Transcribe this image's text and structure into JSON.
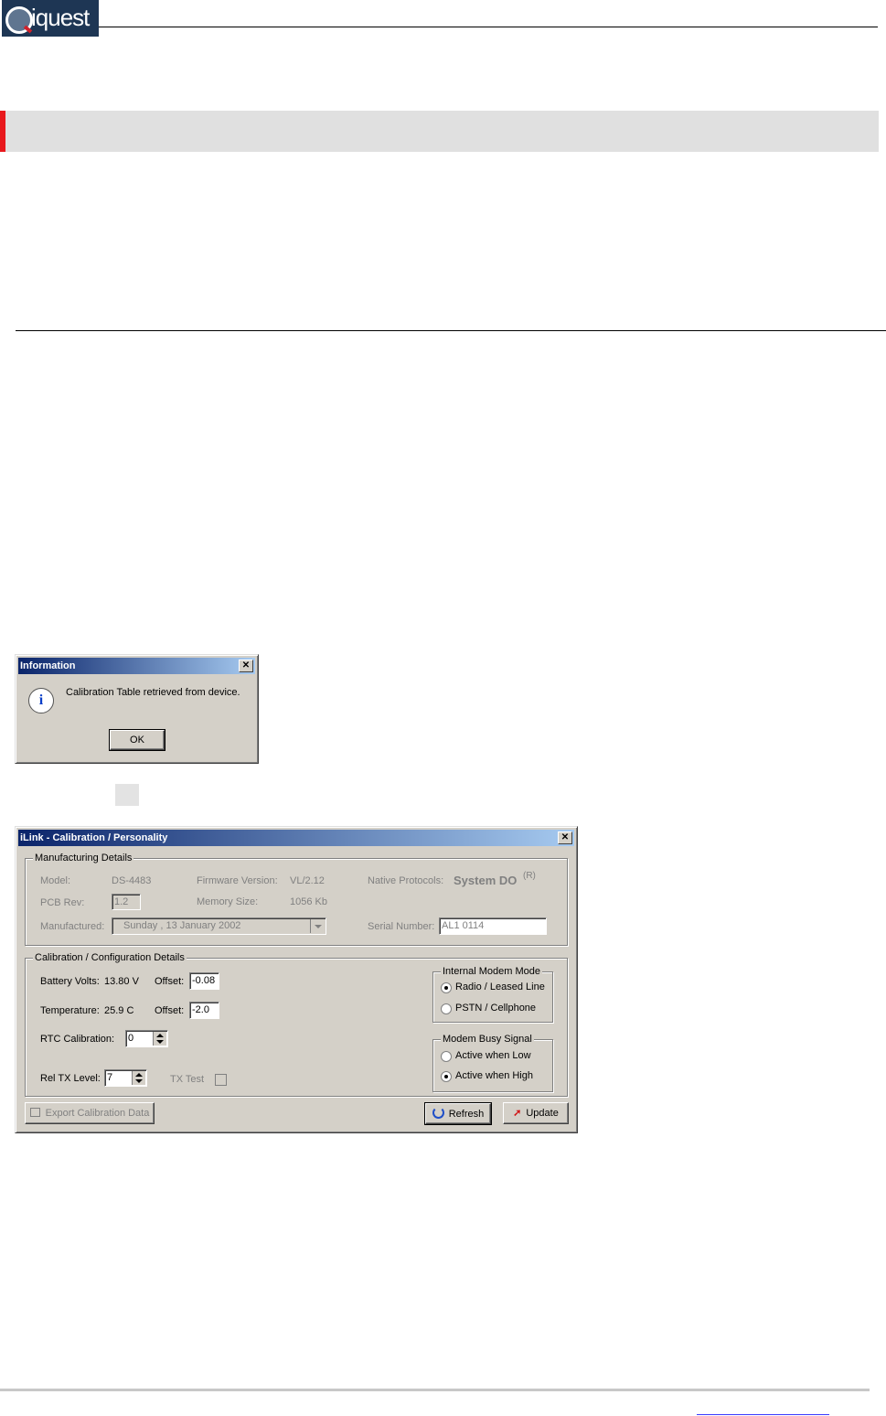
{
  "header": {
    "logo_text": "iquest"
  },
  "info_dialog": {
    "title": "Information",
    "close_glyph": "✕",
    "message": "Calibration Table retrieved from device.",
    "ok_label": "OK"
  },
  "cal_dialog": {
    "title": "iLink - Calibration / Personality",
    "close_glyph": "✕",
    "manufacturing": {
      "caption": "Manufacturing Details",
      "model_label": "Model:",
      "model_value": "DS-4483",
      "firmware_label": "Firmware Version:",
      "firmware_value": "VL/2.12",
      "protocols_label": "Native Protocols:",
      "protocols_value": "System DO",
      "protocols_mark": "(R)",
      "pcb_label": "PCB Rev:",
      "pcb_value": "1.2",
      "memory_label": "Memory Size:",
      "memory_value": "1056 Kb",
      "manufactured_label": "Manufactured:",
      "manufactured_value": "Sunday   , 13   January   2002",
      "serial_label": "Serial Number:",
      "serial_value": "AL1 0114"
    },
    "calibration": {
      "caption": "Calibration / Configuration Details",
      "battery_label": "Battery Volts:",
      "battery_value": "13.80 V",
      "offset_label": "Offset:",
      "battery_offset": "-0.08",
      "temp_label": "Temperature:",
      "temp_value": "25.9 C",
      "temp_offset": "-2.0",
      "rtc_label": "RTC Calibration:",
      "rtc_value": "0",
      "reltx_label": "Rel TX Level:",
      "reltx_value": "7",
      "txtest_label": "TX Test"
    },
    "modem_mode": {
      "caption": "Internal Modem Mode",
      "option1": "Radio / Leased Line",
      "option2": "PSTN / Cellphone",
      "selected": 1
    },
    "busy_signal": {
      "caption": "Modem Busy Signal",
      "option1": "Active when Low",
      "option2": "Active when High",
      "selected": 2
    },
    "export_label": "Export Calibration Data",
    "refresh_label": "Refresh",
    "update_label": "Update"
  }
}
